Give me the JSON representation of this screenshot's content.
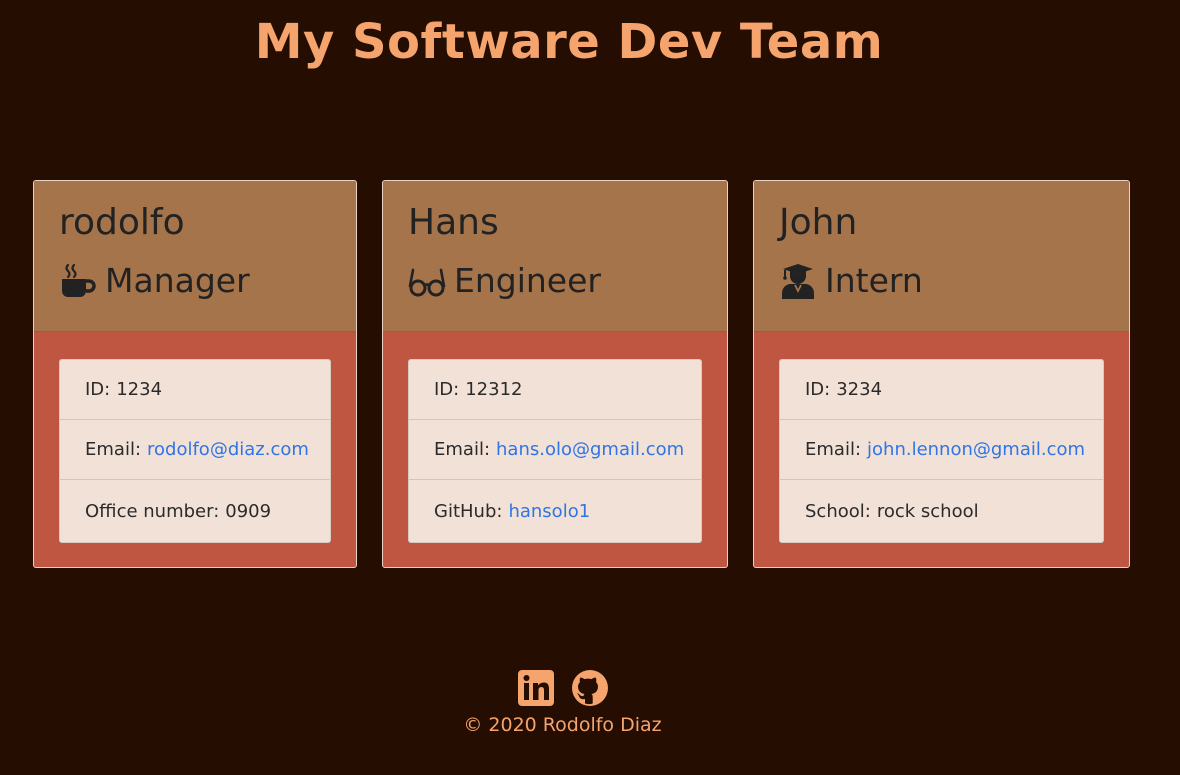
{
  "page": {
    "title": "My Software Dev Team"
  },
  "team": [
    {
      "name": "rodolfo",
      "role": "Manager",
      "role_icon": "coffee-mug-icon",
      "details": [
        {
          "label": "ID:",
          "value": "1234",
          "is_link": false
        },
        {
          "label": "Email:",
          "value": "rodolfo@diaz.com",
          "is_link": true
        },
        {
          "label": "Office number:",
          "value": "0909",
          "is_link": false
        }
      ]
    },
    {
      "name": "Hans",
      "role": "Engineer",
      "role_icon": "glasses-icon",
      "details": [
        {
          "label": "ID:",
          "value": "12312",
          "is_link": false
        },
        {
          "label": "Email:",
          "value": "hans.olo@gmail.com",
          "is_link": true
        },
        {
          "label": "GitHub:",
          "value": "hansolo1",
          "is_link": true
        }
      ]
    },
    {
      "name": "John",
      "role": "Intern",
      "role_icon": "graduate-icon",
      "details": [
        {
          "label": "ID:",
          "value": "3234",
          "is_link": false
        },
        {
          "label": "Email:",
          "value": "john.lennon@gmail.com",
          "is_link": true
        },
        {
          "label": "School:",
          "value": "rock school",
          "is_link": false
        }
      ]
    }
  ],
  "footer": {
    "icons": [
      "linkedin-icon",
      "github-icon"
    ],
    "copyright": "© 2020 Rodolfo Diaz"
  },
  "colors": {
    "background": "#250d01",
    "accent": "#f4a46c",
    "card_header": "#a6744b",
    "card_body": "#be5642",
    "list_background": "#f2e1d7",
    "link": "#2f75e6"
  }
}
